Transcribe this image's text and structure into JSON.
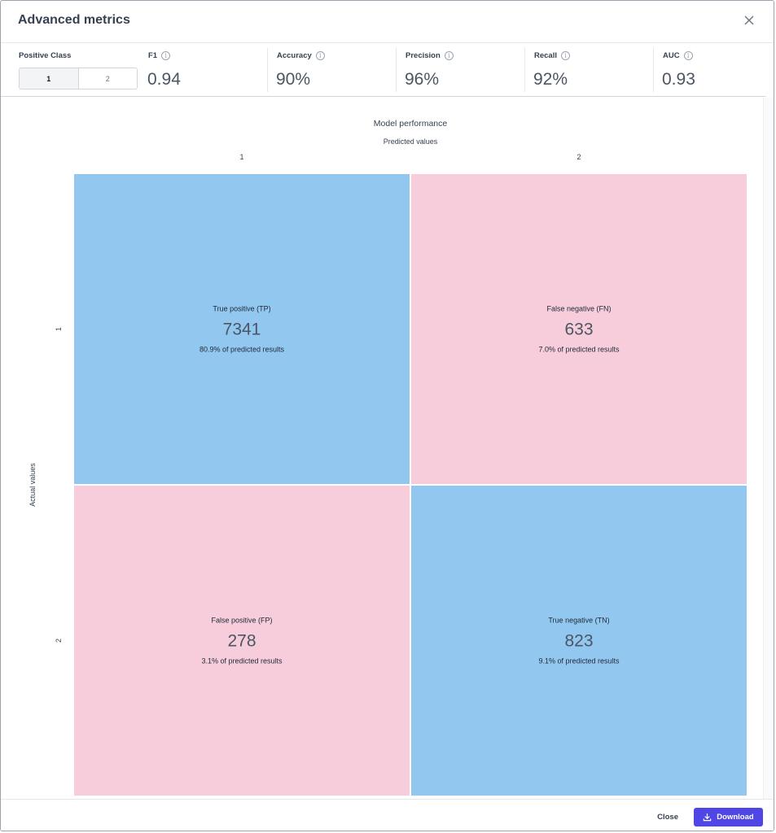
{
  "modal": {
    "title": "Advanced metrics",
    "close_icon": "close-icon"
  },
  "positive_class": {
    "label": "Positive Class",
    "options": [
      "1",
      "2"
    ],
    "selected": "1"
  },
  "metrics": [
    {
      "label": "F1",
      "value": "0.94",
      "icon": "info-icon"
    },
    {
      "label": "Accuracy",
      "value": "90%",
      "icon": "info-icon"
    },
    {
      "label": "Precision",
      "value": "96%",
      "icon": "info-icon"
    },
    {
      "label": "Recall",
      "value": "92%",
      "icon": "info-icon"
    },
    {
      "label": "AUC",
      "value": "0.93",
      "icon": "info-icon"
    }
  ],
  "footer": {
    "close_label": "Close",
    "download_label": "Download",
    "download_icon": "download-icon"
  },
  "colors": {
    "correct": "#92c7f0",
    "incorrect": "#f7cddb",
    "accent": "#4f46e5"
  },
  "chart_data": {
    "type": "heatmap",
    "title": "Model performance",
    "xlabel": "Predicted values",
    "ylabel": "Actual values",
    "x_categories": [
      "1",
      "2"
    ],
    "y_categories": [
      "1",
      "2"
    ],
    "cells": [
      {
        "row": 0,
        "col": 0,
        "label": "True positive (TP)",
        "value": 7341,
        "percent_text": "80.9% of predicted results",
        "kind": "correct"
      },
      {
        "row": 0,
        "col": 1,
        "label": "False negative (FN)",
        "value": 633,
        "percent_text": "7.0% of predicted results",
        "kind": "incorrect"
      },
      {
        "row": 1,
        "col": 0,
        "label": "False positive (FP)",
        "value": 278,
        "percent_text": "3.1% of predicted results",
        "kind": "incorrect"
      },
      {
        "row": 1,
        "col": 1,
        "label": "True negative (TN)",
        "value": 823,
        "percent_text": "9.1% of predicted results",
        "kind": "correct"
      }
    ]
  }
}
